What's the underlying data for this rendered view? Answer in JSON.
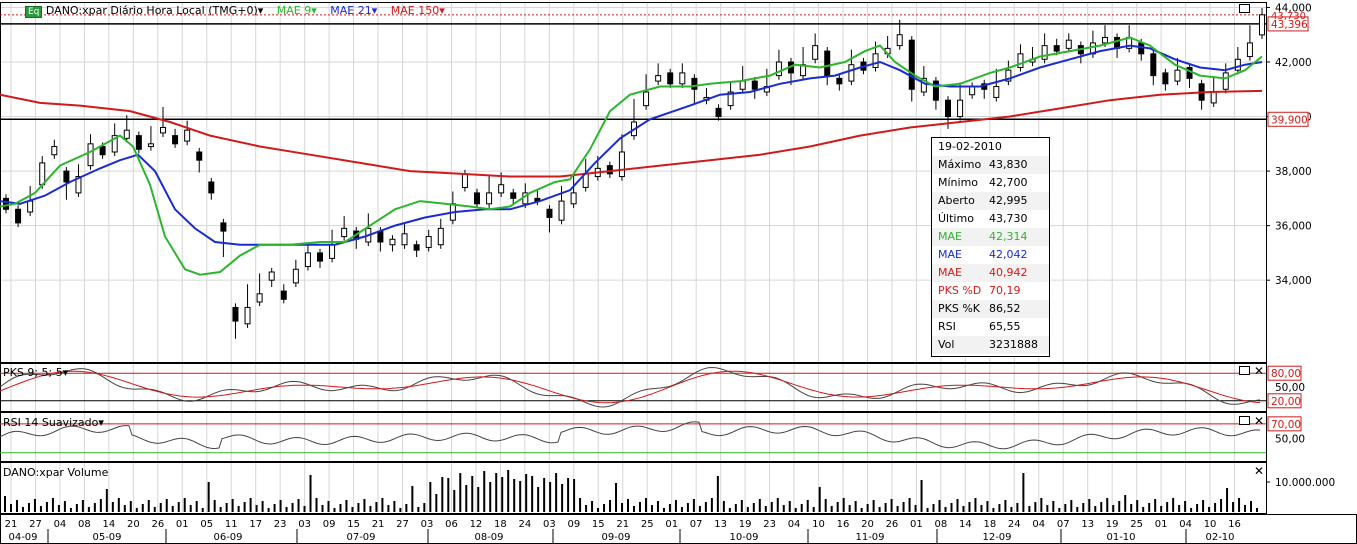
{
  "header": {
    "badge": "Eq",
    "title": "DANO:xpar Diário Hora Local (TMG+0)",
    "ma_fast": "MAE 9",
    "ma_mid": "MAE 21",
    "ma_slow": "MAE 150"
  },
  "panels": {
    "stoch_label": "PKS 9; 5; 5",
    "rsi_label": "RSI 14 Suavizado",
    "volume_label": "DANO:xpar Volume"
  },
  "info": {
    "date": "19-02-2010",
    "rows": [
      {
        "label": "Máximo",
        "value": "43,830",
        "color": "#000000"
      },
      {
        "label": "Mínimo",
        "value": "42,700",
        "color": "#000000"
      },
      {
        "label": "Aberto",
        "value": "42,995",
        "color": "#000000"
      },
      {
        "label": "Último",
        "value": "43,730",
        "color": "#000000"
      },
      {
        "label": "MAE",
        "value": "42,314",
        "color": "#2db52d"
      },
      {
        "label": "MAE",
        "value": "42,042",
        "color": "#1a2bd0"
      },
      {
        "label": "MAE",
        "value": "40,942",
        "color": "#d01a1a"
      },
      {
        "label": "PKS %D",
        "value": "70,19",
        "color": "#d01a1a"
      },
      {
        "label": "PKS %K",
        "value": "86,52",
        "color": "#000000"
      },
      {
        "label": "RSI",
        "value": "65,55",
        "color": "#000000"
      },
      {
        "label": "Vol",
        "value": "3231888",
        "color": "#000000"
      }
    ]
  },
  "colors": {
    "ma_fast": "#2db52d",
    "ma_mid": "#1a2bd0",
    "ma_slow": "#d01a1a",
    "level_tag": "#d01a1a"
  },
  "chart_data": {
    "type": "candlestick",
    "price_ticks": [
      "44,000",
      "42,000",
      "40,000",
      "38,000",
      "36,000",
      "34,000"
    ],
    "price_ylim": [
      31,
      44.2
    ],
    "tags": {
      "last": "43,730",
      "current": "43,396",
      "level": "39,900"
    },
    "horizontal_lines": [
      43.396,
      39.9
    ],
    "stoch_ticks": [
      "80,00",
      "50,00",
      "20,00"
    ],
    "rsi_ticks": [
      "70,00",
      "50,00"
    ],
    "volume_ticks": [
      "10.000.000"
    ],
    "x_days": [
      "21",
      "27",
      "04",
      "08",
      "14",
      "20",
      "26",
      "01",
      "05",
      "11",
      "17",
      "23",
      "03",
      "09",
      "15",
      "21",
      "27",
      "03",
      "06",
      "12",
      "18",
      "24",
      "03",
      "09",
      "15",
      "21",
      "25",
      "01",
      "07",
      "13",
      "19",
      "23",
      "04",
      "10",
      "16",
      "20",
      "26",
      "01",
      "08",
      "14",
      "18",
      "24",
      "04",
      "07",
      "13",
      "19",
      "25",
      "01",
      "04",
      "10",
      "16"
    ],
    "x_months": [
      "04-09",
      "05-09",
      "06-09",
      "07-09",
      "08-09",
      "09-09",
      "10-09",
      "11-09",
      "12-09",
      "01-10",
      "02-10"
    ],
    "ma_fast_path": [
      [
        0,
        36.7
      ],
      [
        15,
        36.8
      ],
      [
        35,
        37.2
      ],
      [
        60,
        38.2
      ],
      [
        90,
        38.7
      ],
      [
        120,
        39.3
      ],
      [
        133,
        38.9
      ],
      [
        150,
        37.5
      ],
      [
        165,
        35.6
      ],
      [
        185,
        34.4
      ],
      [
        200,
        34.2
      ],
      [
        220,
        34.3
      ],
      [
        240,
        34.9
      ],
      [
        260,
        35.3
      ],
      [
        290,
        35.3
      ],
      [
        320,
        35.4
      ],
      [
        345,
        35.4
      ],
      [
        370,
        36.0
      ],
      [
        395,
        36.6
      ],
      [
        420,
        36.9
      ],
      [
        445,
        36.8
      ],
      [
        470,
        36.7
      ],
      [
        490,
        36.6
      ],
      [
        510,
        36.7
      ],
      [
        530,
        37.2
      ],
      [
        555,
        37.6
      ],
      [
        570,
        37.7
      ],
      [
        590,
        38.8
      ],
      [
        610,
        40.2
      ],
      [
        630,
        40.8
      ],
      [
        660,
        41.1
      ],
      [
        690,
        41.1
      ],
      [
        710,
        41.2
      ],
      [
        740,
        41.3
      ],
      [
        770,
        41.5
      ],
      [
        795,
        41.9
      ],
      [
        820,
        41.8
      ],
      [
        845,
        42.0
      ],
      [
        865,
        42.4
      ],
      [
        880,
        42.6
      ],
      [
        895,
        42.0
      ],
      [
        915,
        41.5
      ],
      [
        935,
        41.1
      ],
      [
        960,
        41.2
      ],
      [
        990,
        41.6
      ],
      [
        1010,
        41.8
      ],
      [
        1040,
        42.2
      ],
      [
        1070,
        42.4
      ],
      [
        1100,
        42.6
      ],
      [
        1130,
        42.9
      ],
      [
        1150,
        42.6
      ],
      [
        1175,
        41.9
      ],
      [
        1200,
        41.5
      ],
      [
        1225,
        41.4
      ],
      [
        1245,
        41.7
      ],
      [
        1262,
        42.2
      ]
    ],
    "ma_mid_path": [
      [
        0,
        36.9
      ],
      [
        20,
        36.8
      ],
      [
        45,
        37.1
      ],
      [
        70,
        37.6
      ],
      [
        100,
        38.1
      ],
      [
        120,
        38.4
      ],
      [
        138,
        38.6
      ],
      [
        155,
        38.0
      ],
      [
        175,
        36.6
      ],
      [
        195,
        35.9
      ],
      [
        215,
        35.4
      ],
      [
        240,
        35.3
      ],
      [
        265,
        35.3
      ],
      [
        300,
        35.3
      ],
      [
        335,
        35.3
      ],
      [
        365,
        35.6
      ],
      [
        395,
        36.0
      ],
      [
        425,
        36.3
      ],
      [
        455,
        36.5
      ],
      [
        485,
        36.6
      ],
      [
        510,
        36.6
      ],
      [
        540,
        36.9
      ],
      [
        570,
        37.3
      ],
      [
        595,
        38.3
      ],
      [
        620,
        39.2
      ],
      [
        650,
        39.9
      ],
      [
        690,
        40.4
      ],
      [
        720,
        40.8
      ],
      [
        750,
        40.9
      ],
      [
        780,
        41.2
      ],
      [
        810,
        41.4
      ],
      [
        835,
        41.5
      ],
      [
        860,
        41.8
      ],
      [
        880,
        42.0
      ],
      [
        900,
        41.7
      ],
      [
        925,
        41.2
      ],
      [
        950,
        41.1
      ],
      [
        980,
        41.1
      ],
      [
        1010,
        41.4
      ],
      [
        1040,
        41.8
      ],
      [
        1070,
        42.1
      ],
      [
        1100,
        42.4
      ],
      [
        1130,
        42.6
      ],
      [
        1150,
        42.5
      ],
      [
        1175,
        42.1
      ],
      [
        1200,
        41.8
      ],
      [
        1225,
        41.7
      ],
      [
        1245,
        41.9
      ],
      [
        1262,
        42.0
      ]
    ],
    "ma_slow_path": [
      [
        0,
        40.8
      ],
      [
        40,
        40.5
      ],
      [
        80,
        40.4
      ],
      [
        130,
        40.2
      ],
      [
        170,
        39.8
      ],
      [
        210,
        39.3
      ],
      [
        260,
        38.9
      ],
      [
        310,
        38.6
      ],
      [
        360,
        38.3
      ],
      [
        410,
        38.0
      ],
      [
        460,
        37.9
      ],
      [
        510,
        37.8
      ],
      [
        560,
        37.8
      ],
      [
        610,
        38.0
      ],
      [
        660,
        38.2
      ],
      [
        710,
        38.4
      ],
      [
        760,
        38.6
      ],
      [
        810,
        38.9
      ],
      [
        860,
        39.3
      ],
      [
        910,
        39.6
      ],
      [
        960,
        39.8
      ],
      [
        1010,
        40.0
      ],
      [
        1060,
        40.3
      ],
      [
        1110,
        40.6
      ],
      [
        1160,
        40.8
      ],
      [
        1210,
        40.9
      ],
      [
        1262,
        40.94
      ]
    ],
    "candles": [
      [
        37.0,
        36.6,
        36.9
      ],
      [
        36.6,
        36.1,
        36.5
      ],
      [
        36.5,
        36.9,
        37.3
      ],
      [
        37.5,
        38.3,
        38.4
      ],
      [
        38.6,
        38.9,
        39.0
      ],
      [
        38.0,
        37.6,
        37.1
      ],
      [
        37.2,
        37.8,
        38.1
      ],
      [
        38.2,
        39.0,
        39.2
      ],
      [
        38.9,
        38.6,
        38.9
      ],
      [
        38.7,
        39.3,
        39.6
      ],
      [
        39.2,
        39.5,
        39.9
      ],
      [
        39.3,
        38.8,
        38.8
      ],
      [
        38.9,
        39.0,
        39.5
      ],
      [
        39.4,
        39.6,
        40.2
      ],
      [
        39.3,
        39.0,
        39.4
      ],
      [
        39.1,
        39.5,
        39.7
      ],
      [
        38.7,
        38.4,
        38.1
      ],
      [
        37.6,
        37.2,
        37.1
      ],
      [
        36.1,
        35.8,
        35.0
      ],
      [
        33.0,
        32.5,
        32.0
      ],
      [
        32.4,
        33.0,
        33.7
      ],
      [
        33.2,
        33.5,
        34.1
      ],
      [
        34.0,
        34.3,
        33.9
      ],
      [
        33.6,
        33.3,
        33.7
      ],
      [
        33.9,
        34.4,
        34.6
      ],
      [
        34.5,
        35.0,
        35.2
      ],
      [
        35.0,
        34.7,
        34.6
      ],
      [
        34.8,
        35.3,
        35.7
      ],
      [
        35.6,
        35.9,
        36.2
      ],
      [
        35.8,
        35.5,
        35.3
      ],
      [
        35.4,
        35.9,
        36.3
      ],
      [
        35.8,
        35.4,
        35.2
      ],
      [
        35.3,
        35.5,
        35.2
      ],
      [
        35.3,
        35.7,
        35.9
      ],
      [
        35.3,
        35.1,
        35.0
      ],
      [
        35.2,
        35.6,
        35.7
      ],
      [
        35.3,
        35.9,
        36.1
      ],
      [
        36.2,
        36.8,
        37.1
      ],
      [
        37.4,
        37.9,
        37.9
      ],
      [
        37.2,
        36.8,
        36.8
      ],
      [
        36.8,
        37.2,
        37.7
      ],
      [
        37.2,
        37.5,
        37.8
      ],
      [
        37.2,
        37.0,
        36.9
      ],
      [
        36.8,
        37.2,
        37.4
      ],
      [
        37.0,
        36.9,
        37.2
      ],
      [
        36.6,
        36.3,
        35.9
      ],
      [
        36.2,
        36.9,
        37.3
      ],
      [
        36.8,
        37.2,
        37.7
      ],
      [
        37.4,
        37.9,
        38.3
      ],
      [
        37.8,
        38.1,
        38.4
      ],
      [
        38.2,
        37.9,
        38.1
      ],
      [
        37.8,
        38.7,
        39.2
      ],
      [
        39.3,
        39.8,
        40.5
      ],
      [
        40.4,
        40.9,
        41.4
      ],
      [
        41.3,
        41.5,
        41.8
      ],
      [
        41.6,
        41.2,
        41.3
      ],
      [
        41.2,
        41.6,
        41.8
      ],
      [
        41.4,
        41.0,
        40.6
      ],
      [
        40.6,
        40.7,
        40.9
      ],
      [
        40.3,
        40.0,
        40.2
      ],
      [
        40.4,
        40.9,
        41.1
      ],
      [
        41.0,
        41.3,
        41.7
      ],
      [
        41.3,
        41.0,
        40.8
      ],
      [
        40.9,
        41.1,
        41.6
      ],
      [
        41.5,
        42.0,
        42.3
      ],
      [
        42.0,
        41.6,
        41.3
      ],
      [
        41.5,
        41.9,
        42.4
      ],
      [
        42.1,
        42.6,
        42.9
      ],
      [
        42.4,
        41.5,
        41.3
      ],
      [
        41.4,
        41.2,
        41.1
      ],
      [
        41.3,
        41.9,
        42.3
      ],
      [
        42.0,
        41.7,
        42.0
      ],
      [
        41.8,
        42.3,
        42.6
      ],
      [
        42.3,
        42.5,
        42.8
      ],
      [
        42.6,
        43.0,
        43.4
      ],
      [
        42.8,
        41.0,
        40.7
      ],
      [
        40.9,
        41.4,
        41.7
      ],
      [
        41.3,
        40.6,
        40.4
      ],
      [
        40.6,
        40.0,
        39.7
      ],
      [
        40.0,
        40.6,
        41.1
      ],
      [
        40.8,
        41.1,
        41.1
      ],
      [
        41.2,
        41.0,
        40.8
      ],
      [
        40.7,
        41.1,
        41.6
      ],
      [
        41.3,
        41.7,
        41.9
      ],
      [
        41.8,
        42.3,
        42.5
      ],
      [
        42.0,
        42.1,
        42.4
      ],
      [
        42.1,
        42.6,
        42.9
      ],
      [
        42.6,
        42.4,
        42.7
      ],
      [
        42.5,
        42.8,
        42.9
      ],
      [
        42.6,
        42.3,
        42.1
      ],
      [
        42.3,
        42.7,
        43.0
      ],
      [
        42.7,
        42.9,
        43.2
      ],
      [
        42.9,
        42.5,
        42.3
      ],
      [
        42.5,
        42.9,
        43.2
      ],
      [
        42.7,
        42.3,
        42.2
      ],
      [
        42.3,
        41.5,
        41.3
      ],
      [
        41.6,
        41.2,
        41.1
      ],
      [
        41.3,
        41.7,
        42.0
      ],
      [
        41.8,
        41.4,
        41.2
      ],
      [
        41.2,
        40.6,
        40.4
      ],
      [
        40.5,
        40.9,
        41.3
      ],
      [
        41.0,
        41.6,
        41.8
      ],
      [
        41.7,
        42.1,
        42.4
      ],
      [
        42.2,
        42.7,
        43.2
      ],
      [
        42.995,
        43.73,
        43.83
      ]
    ]
  }
}
